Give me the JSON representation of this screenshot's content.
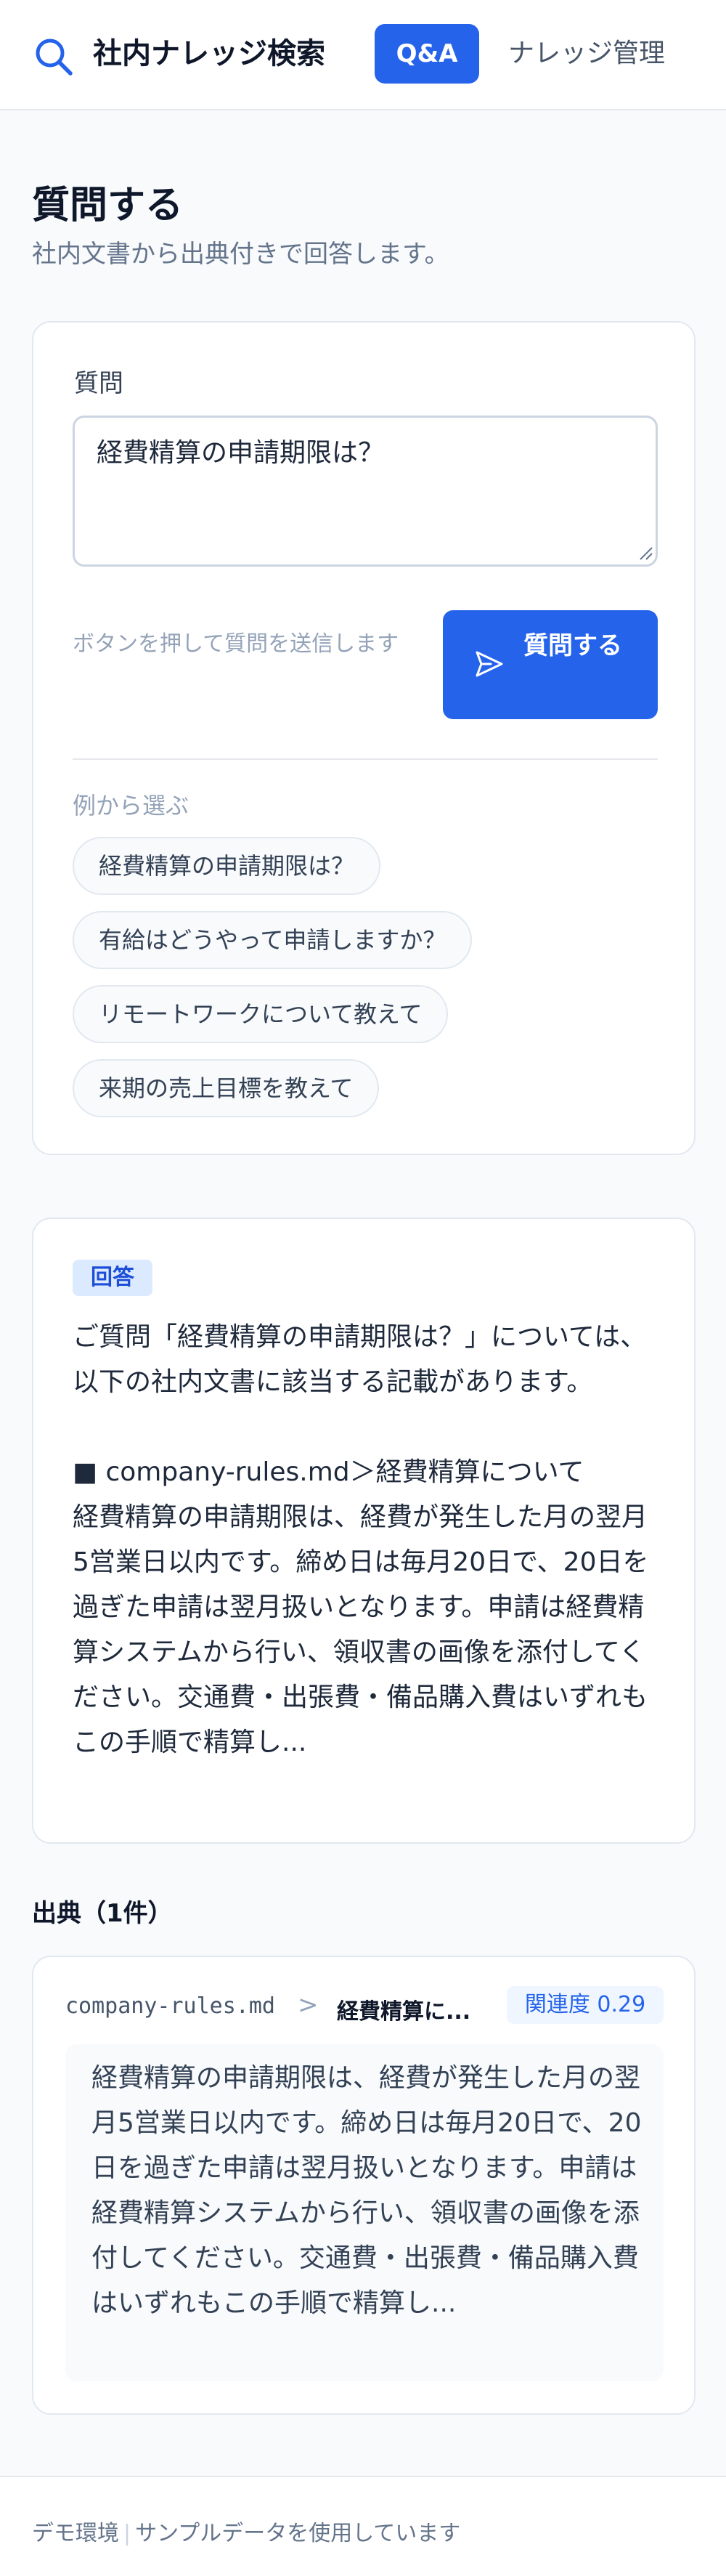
{
  "header": {
    "app_title": "社内ナレッジ検索",
    "nav": {
      "qa_label": "Q&A",
      "manage_label": "ナレッジ管理"
    },
    "logo_icon": "search-icon"
  },
  "page": {
    "title": "質問する",
    "subtitle": "社内文書から出典付きで回答します。"
  },
  "question_form": {
    "label": "質問",
    "value": "経費精算の申請期限は？",
    "hint": "ボタンを押して質問を送信します",
    "submit_label": "質問する",
    "submit_icon": "send-icon",
    "examples_label": "例から選ぶ",
    "examples": [
      "経費精算の申請期限は？",
      "有給はどうやって申請しますか？",
      "リモートワークについて教えて",
      "来期の売上目標を教えて"
    ]
  },
  "answer": {
    "badge": "回答",
    "intro": "ご質問「経費精算の申請期限は？」については、以下の社内文書に該当する記載があります。",
    "source_heading": "■ company-rules.md＞経費精算について",
    "body": "経費精算の申請期限は、経費が発生した月の翌月5営業日以内です。締め日は毎月20日で、20日を過ぎた申請は翌月扱いとなります。申請は経費精算システムから行い、領収書の画像を添付してください。交通費・出張費・備品購入費はいずれもこの手順で精算し..."
  },
  "sources": {
    "title": "出典（1件）",
    "items": [
      {
        "file": "company-rules.md",
        "separator": ">",
        "section": "経費精算に...",
        "relevance_label": "関連度",
        "relevance": "0.29",
        "excerpt": "経費精算の申請期限は、経費が発生した月の翌月5営業日以内です。締め日は毎月20日で、20日を過ぎた申請は翌月扱いとなります。申請は経費精算システムから行い、領収書の画像を添付してください。交通費・出張費・備品購入費はいずれもこの手順で精算し..."
      }
    ]
  },
  "footer": {
    "env": "デモ環境",
    "separator": "|",
    "note": "サンプルデータを使用しています"
  },
  "colors": {
    "accent": "#2563eb",
    "badge_bg": "#dbeafe",
    "text": "#1e293b",
    "muted": "#94a3b8"
  }
}
